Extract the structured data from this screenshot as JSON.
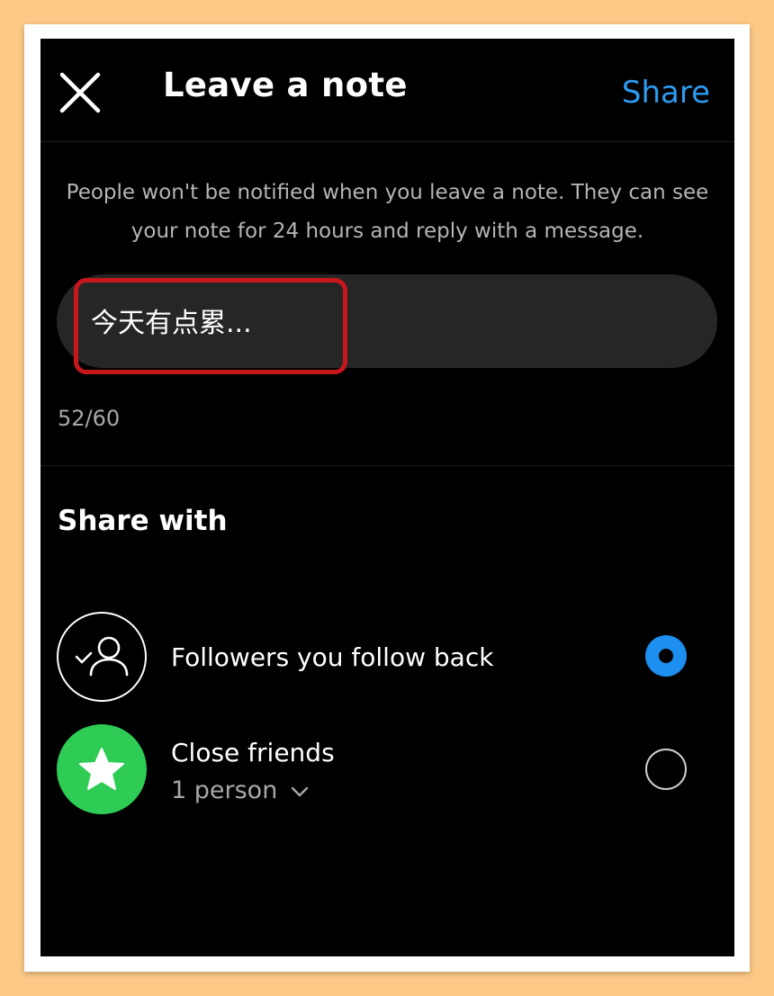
{
  "header": {
    "title": "Leave a note",
    "share_label": "Share"
  },
  "info": {
    "line1": "People won't be notified when you leave a note. They can see",
    "line2": "your note for 24 hours and reply with a message."
  },
  "note": {
    "value": "今天有点累...",
    "counter": "52/60"
  },
  "share_with": {
    "title": "Share with",
    "options": [
      {
        "label": "Followers you follow back",
        "selected": true,
        "icon": "user-check-icon"
      },
      {
        "label": "Close friends",
        "sublabel": "1 person",
        "selected": false,
        "icon": "star-icon"
      }
    ]
  },
  "colors": {
    "accent": "#2c9bf0",
    "radio_selected": "#1d8ff0",
    "close_friends_green": "#2ecc55",
    "highlight_red": "#c8161d",
    "page_background": "#fcc987"
  }
}
